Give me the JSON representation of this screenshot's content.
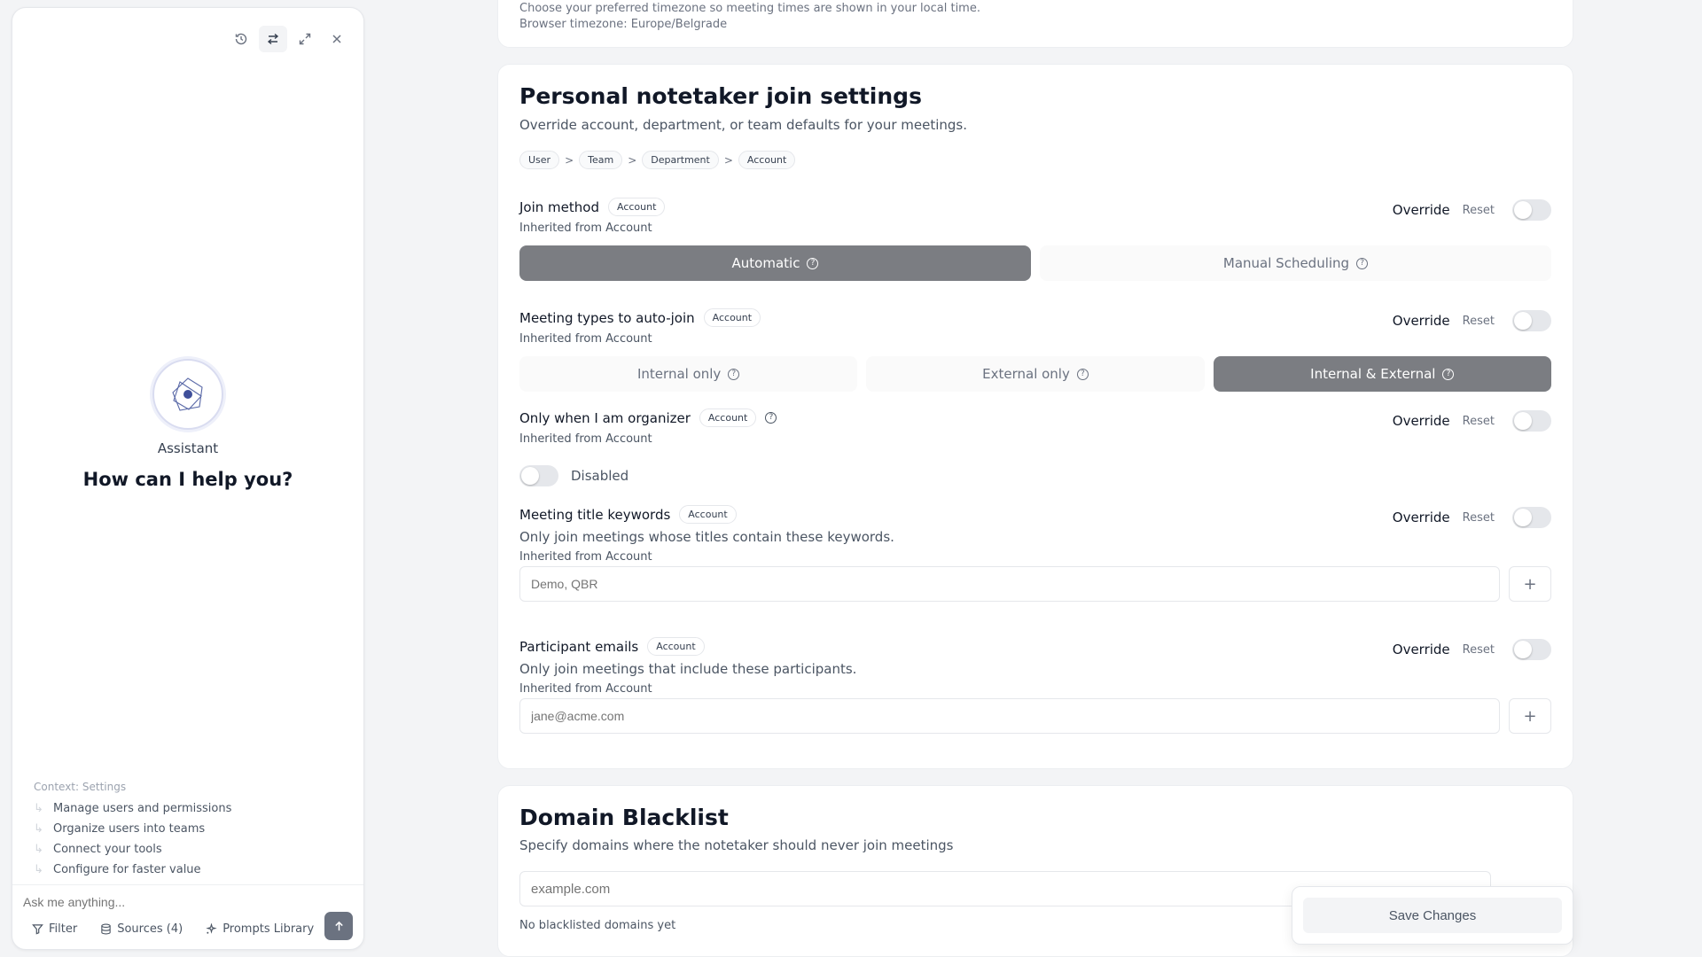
{
  "assistant": {
    "name": "Assistant",
    "greeting": "How can I help you?",
    "context_title": "Context: Settings",
    "context_items": [
      "Manage users and permissions",
      "Organize users into teams",
      "Connect your tools",
      "Configure for faster value"
    ],
    "input_placeholder": "Ask me anything...",
    "tools": {
      "filter": "Filter",
      "sources": "Sources (4)",
      "prompts": "Prompts Library"
    }
  },
  "timezone": {
    "description": "Choose your preferred timezone so meeting times are shown in your local time.",
    "browser_timezone": "Browser timezone: Europe/Belgrade"
  },
  "notetaker": {
    "title": "Personal notetaker join settings",
    "subtitle": "Override account, department, or team defaults for your meetings.",
    "breadcrumb": [
      "User",
      "Team",
      "Department",
      "Account"
    ],
    "breadcrumb_sep": ">",
    "override_label": "Override",
    "reset_label": "Reset",
    "settings": {
      "join_method": {
        "label": "Join method",
        "scope": "Account",
        "inherited": "Inherited from Account",
        "options": [
          "Automatic",
          "Manual Scheduling"
        ],
        "selected": "Automatic"
      },
      "meeting_types": {
        "label": "Meeting types to auto-join",
        "scope": "Account",
        "inherited": "Inherited from Account",
        "options": [
          "Internal only",
          "External only",
          "Internal & External"
        ],
        "selected": "Internal & External"
      },
      "organizer": {
        "label": "Only when I am organizer",
        "scope": "Account",
        "inherited": "Inherited from Account",
        "state_label": "Disabled"
      },
      "title_keywords": {
        "label": "Meeting title keywords",
        "scope": "Account",
        "description": "Only join meetings whose titles contain these keywords.",
        "inherited": "Inherited from Account",
        "placeholder": "Demo, QBR",
        "add": "+"
      },
      "participant_emails": {
        "label": "Participant emails",
        "scope": "Account",
        "description": "Only join meetings that include these participants.",
        "inherited": "Inherited from Account",
        "placeholder": "jane@acme.com",
        "add": "+"
      }
    }
  },
  "domain_blacklist": {
    "title": "Domain Blacklist",
    "subtitle": "Specify domains where the notetaker should never join meetings",
    "placeholder": "example.com",
    "empty": "No blacklisted domains yet"
  },
  "save_label": "Save Changes",
  "colors": {
    "selected_segment": "#7b7d82",
    "toggle_off": "#e5e7eb",
    "page_bg": "#f3f4f6"
  }
}
